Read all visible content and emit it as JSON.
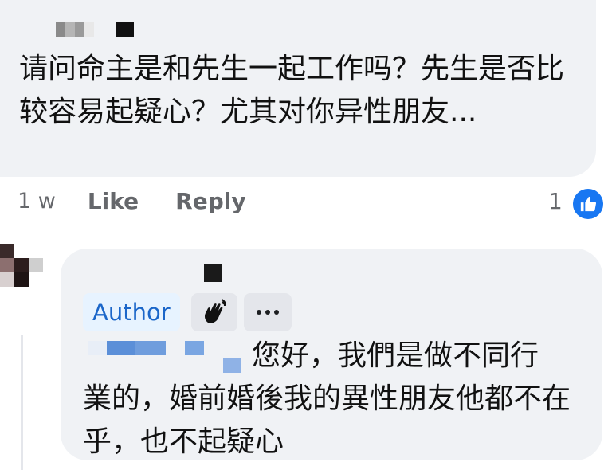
{
  "comment": {
    "text": "请问命主是和先生一起工作吗？先生是否比较容易起疑心？尤其对你异性朋友...",
    "time": "1 w",
    "like_label": "Like",
    "reply_label": "Reply",
    "reaction_count": "1",
    "reaction_icon": "thumbs-up-icon"
  },
  "reply": {
    "badge_label": "Author",
    "badge_icon": "wave-hand-icon",
    "more_icon": "more-dots-icon",
    "line1": "您好，我們是做不同行",
    "line_rest": "業的，婚前婚後我的異性朋友他都不在乎，也不起疑心"
  },
  "colors": {
    "bubble": "#f0f2f5",
    "meta_gray": "#65676b",
    "like_blue": "#1877f2",
    "author_badge_bg": "#e7f3ff",
    "author_badge_text": "#1b66c9"
  }
}
